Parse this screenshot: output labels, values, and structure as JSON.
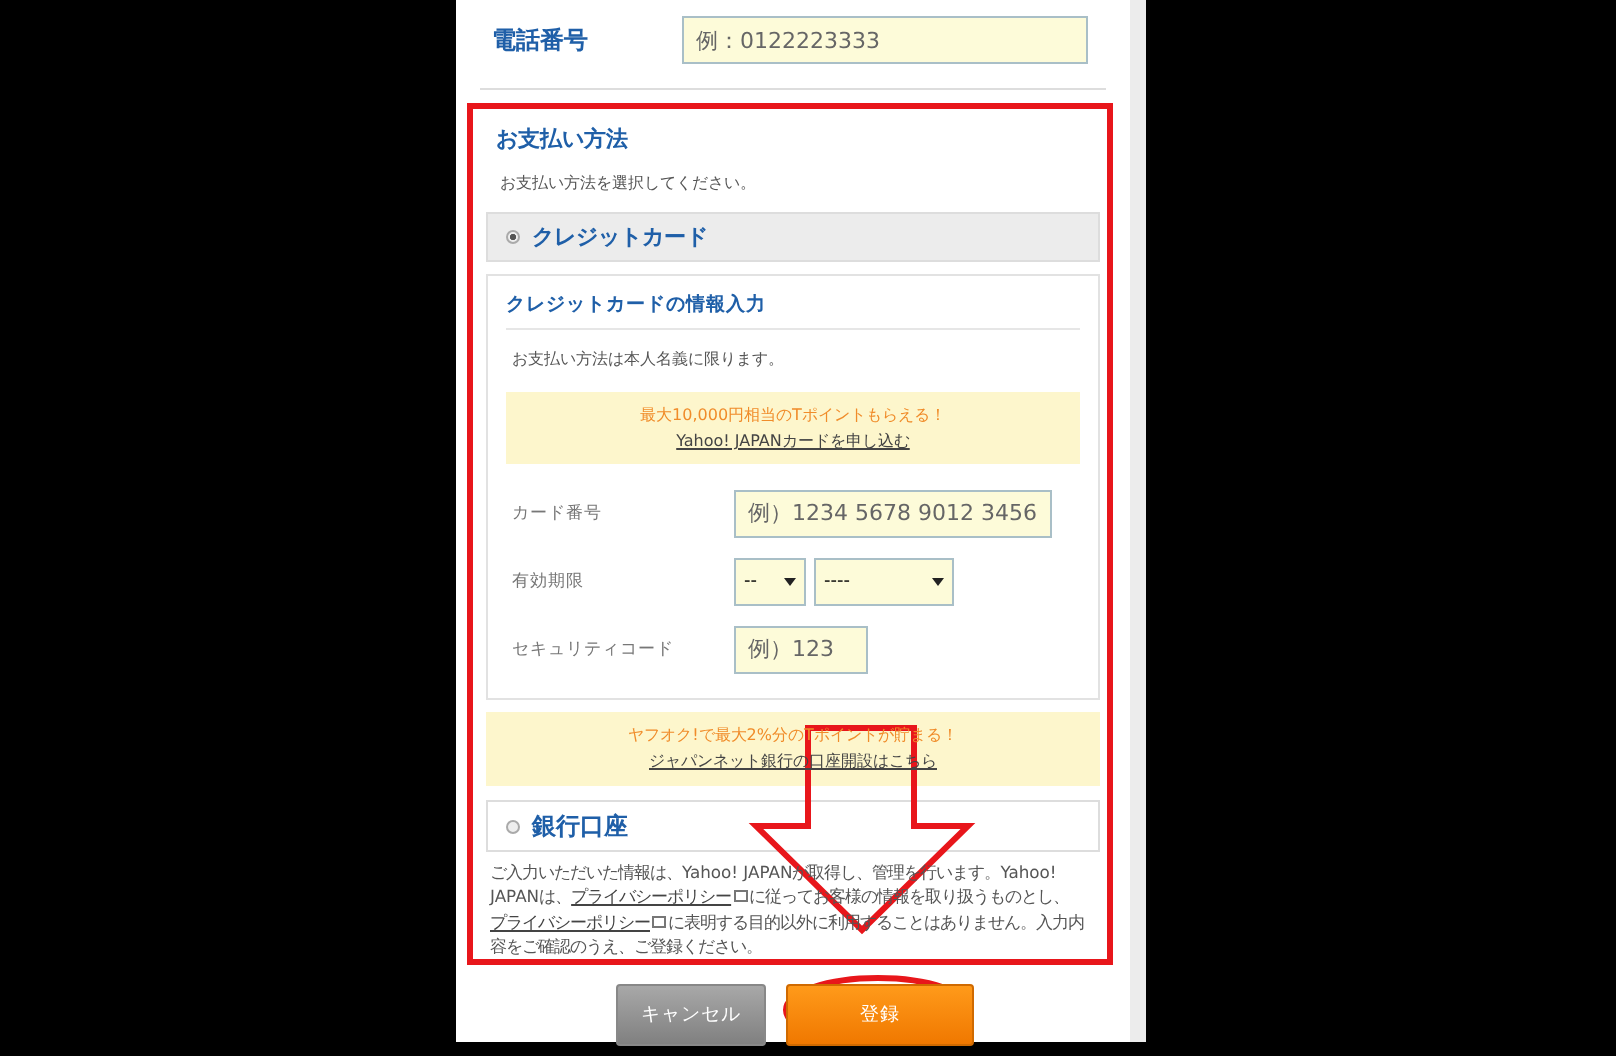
{
  "phone": {
    "label": "電話番号",
    "placeholder": "例：0122223333"
  },
  "payment": {
    "title": "お支払い方法",
    "instruction": "お支払い方法を選択してください。",
    "options": [
      {
        "label": "クレジットカード",
        "selected": true
      },
      {
        "label": "銀行口座",
        "selected": false
      }
    ],
    "card_panel": {
      "title": "クレジットカードの情報入力",
      "note": "お支払い方法は本人名義に限ります。",
      "promo": {
        "text": "最大10,000円相当のTポイントもらえる！",
        "link": "Yahoo! JAPANカードを申し込む"
      },
      "fields": [
        {
          "kind": "text",
          "label": "カード番号",
          "placeholder": "例）1234 5678 9012 3456"
        },
        {
          "kind": "select",
          "label": "有効期限",
          "values": [
            "--",
            "----"
          ]
        },
        {
          "kind": "text",
          "label": "セキュリティコード",
          "placeholder": "例）123"
        }
      ]
    },
    "bank_promo": {
      "text": "ヤフオク!で最大2%分のTポイントが貯まる！",
      "link": "ジャパンネット銀行の口座開設はこちら"
    },
    "notice": [
      {
        "kind": "text",
        "text": "ご入力いただいた情報は、Yahoo! JAPANが取得し、管理を行います。Yahoo! JAPANは、"
      },
      {
        "kind": "link",
        "text": "プライバシーポリシー"
      },
      {
        "kind": "text",
        "text": "に従ってお客様の情報を取り扱うものとし、"
      },
      {
        "kind": "link",
        "text": "プライバシーポリシー"
      },
      {
        "kind": "text",
        "text": "に表明する目的以外に利用することはありません。入力内容をご確認のうえ、ご登録ください。"
      }
    ]
  },
  "buttons": [
    {
      "kind": "cancel",
      "label": "キャンセル"
    },
    {
      "kind": "submit",
      "label": "登録"
    }
  ]
}
